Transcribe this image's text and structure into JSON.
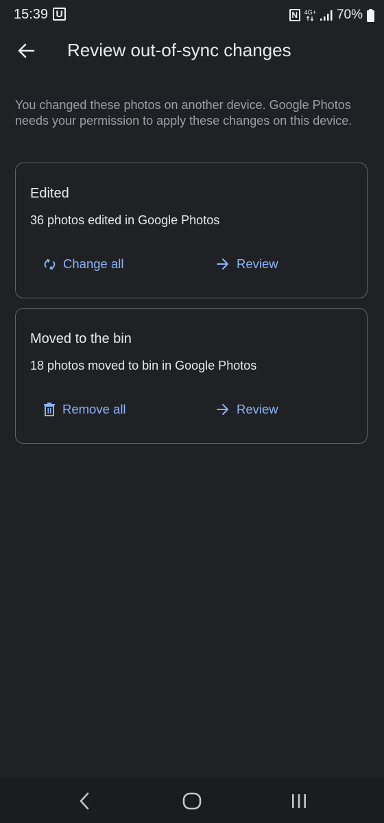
{
  "status_bar": {
    "time": "15:39",
    "carrier_badge": "U",
    "nfc_badge": "N",
    "network_type": "4G+",
    "battery": "70%"
  },
  "app_bar": {
    "title": "Review out-of-sync changes",
    "back_icon": "arrow-back-icon"
  },
  "description": "You changed these photos on another device. Google Photos needs your permission to apply these changes on this device.",
  "cards": [
    {
      "title": "Edited",
      "text": "36 photos edited in Google Photos",
      "primary_action": {
        "label": "Change all",
        "icon": "sync-icon"
      },
      "secondary_action": {
        "label": "Review",
        "icon": "arrow-forward-icon"
      }
    },
    {
      "title": "Moved to the bin",
      "text": "18 photos moved to bin in Google Photos",
      "primary_action": {
        "label": "Remove all",
        "icon": "trash-icon"
      },
      "secondary_action": {
        "label": "Review",
        "icon": "arrow-forward-icon"
      }
    }
  ],
  "nav_bar": {
    "back_icon": "nav-back-icon",
    "home_icon": "nav-home-icon",
    "recents_icon": "nav-recents-icon"
  },
  "colors": {
    "background": "#202124",
    "accent": "#8ab4f8",
    "card_border": "#5f6368",
    "secondary_text": "#9aa0a6"
  }
}
